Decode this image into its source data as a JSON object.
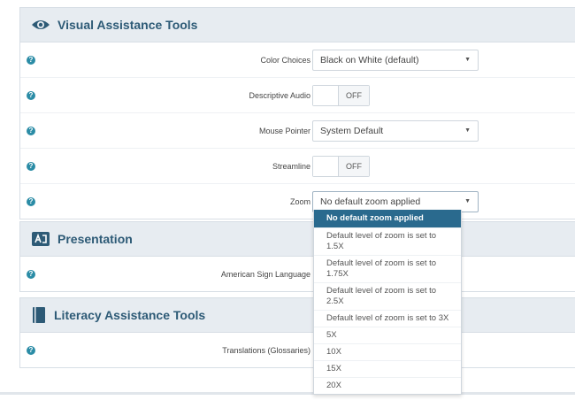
{
  "sections": [
    {
      "title": "Visual Assistance Tools",
      "icon": "eye-icon",
      "rows": [
        {
          "label": "Color Choices",
          "control": "select",
          "value": "Black on White (default)"
        },
        {
          "label": "Descriptive Audio",
          "control": "toggle",
          "value": "OFF"
        },
        {
          "label": "Mouse Pointer",
          "control": "select",
          "value": "System Default"
        },
        {
          "label": "Streamline",
          "control": "toggle",
          "value": "OFF"
        },
        {
          "label": "Zoom",
          "control": "select",
          "value": "No default zoom applied"
        }
      ]
    },
    {
      "title": "Presentation",
      "icon": "sign-language-icon",
      "rows": [
        {
          "label": "American Sign Language"
        }
      ]
    },
    {
      "title": "Literacy Assistance Tools",
      "icon": "book-icon",
      "rows": [
        {
          "label": "Translations (Glossaries)"
        }
      ]
    }
  ],
  "zoom_dropdown": {
    "options": [
      "No default zoom applied",
      "Default level of zoom is set to 1.5X",
      "Default level of zoom is set to 1.75X",
      "Default level of zoom is set to 2.5X",
      "Default level of zoom is set to 3X",
      "5X",
      "10X",
      "15X",
      "20X"
    ],
    "selected_index": 0
  },
  "help_icon_text": "?",
  "colors": {
    "accent": "#2a6a8e",
    "header_bg": "#e7ecf1",
    "title": "#2d5a76",
    "help_icon": "#2b8ca6"
  }
}
